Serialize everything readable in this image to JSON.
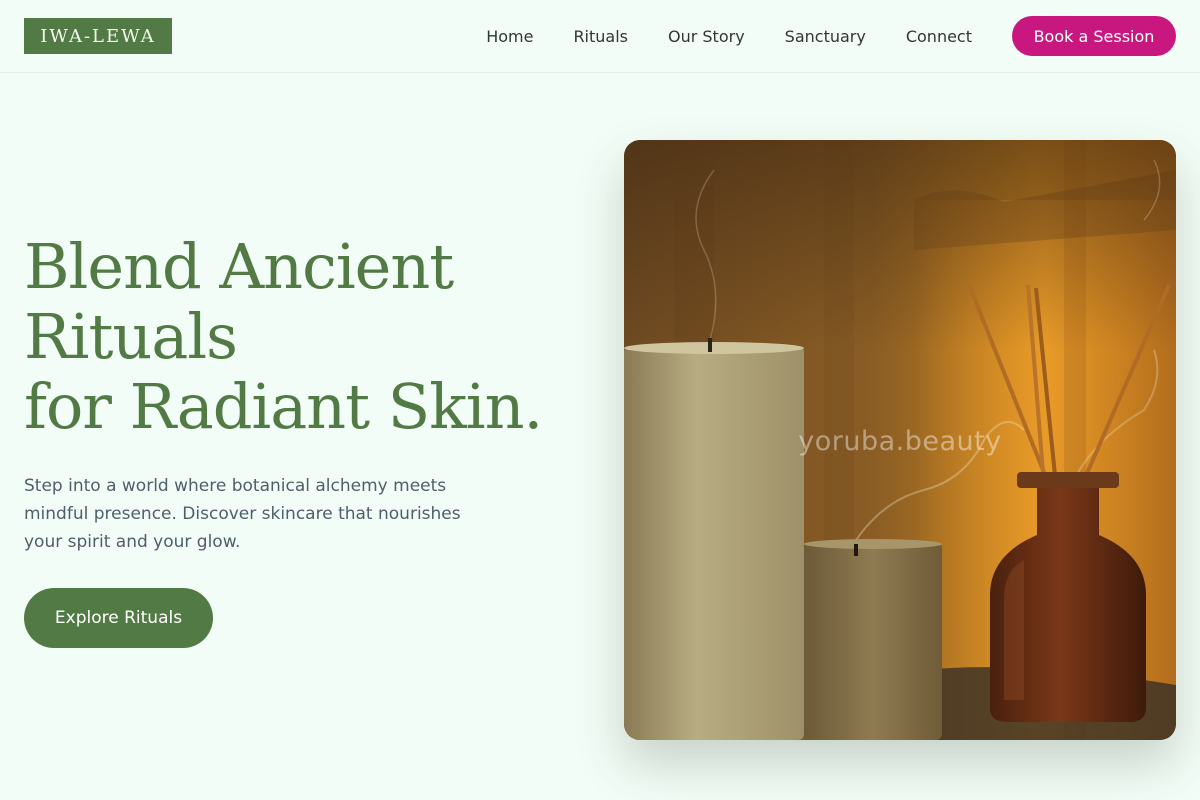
{
  "header": {
    "logo": "IWA-LEWA",
    "nav": [
      "Home",
      "Rituals",
      "Our Story",
      "Sanctuary",
      "Connect"
    ],
    "cta": "Book a Session"
  },
  "hero": {
    "title_lines": [
      "Blend Ancient",
      "Rituals",
      "for Radiant Skin."
    ],
    "description": "Step into a world where botanical alchemy meets mindful presence. Discover skincare that nourishes your spirit and your glow.",
    "button": "Explore Rituals",
    "image_watermark": "yoruba.beauty"
  },
  "colors": {
    "brand_green": "#527a44",
    "accent_magenta": "#c8187f",
    "background": "#f3fdf7"
  }
}
